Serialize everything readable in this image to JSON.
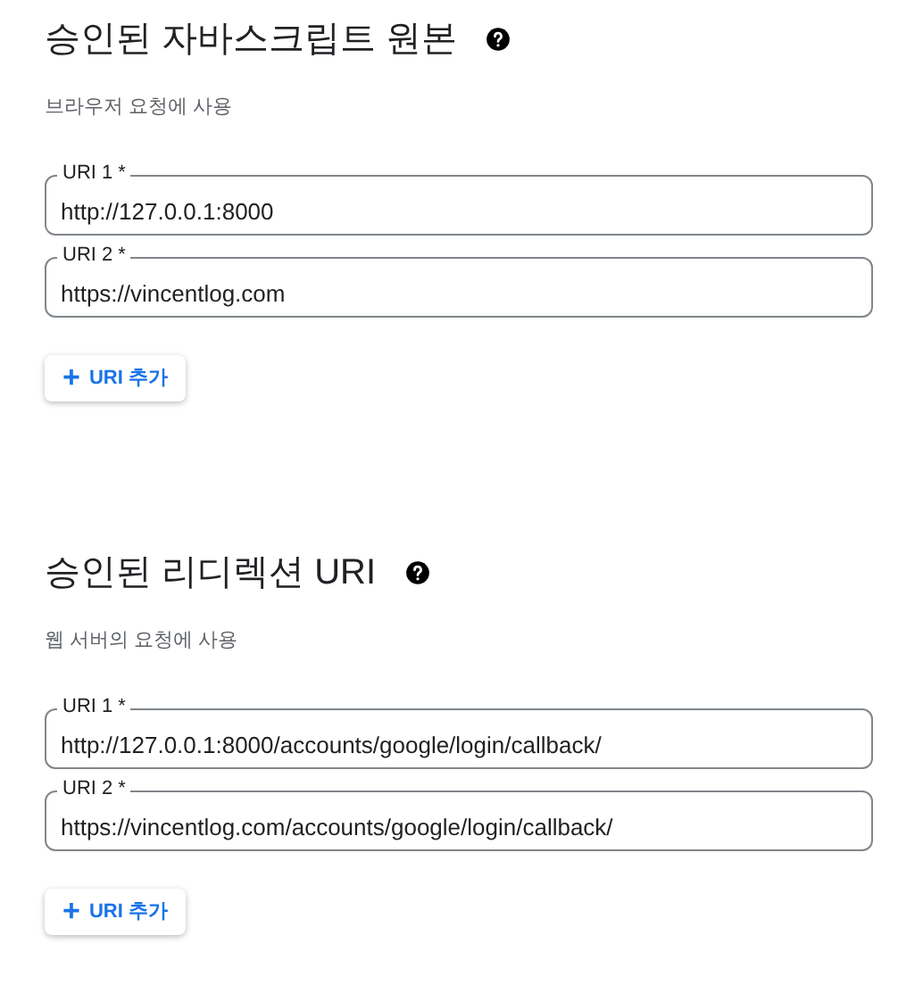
{
  "sections": [
    {
      "title": "승인된 자바스크립트 원본",
      "subtitle": "브라우저 요청에 사용",
      "fields": [
        {
          "label": "URI 1 *",
          "value": "http://127.0.0.1:8000"
        },
        {
          "label": "URI 2 *",
          "value": "https://vincentlog.com"
        }
      ],
      "add_button": {
        "icon": "+",
        "label": "URI 추가"
      }
    },
    {
      "title": "승인된 리디렉션 URI",
      "subtitle": "웹 서버의 요청에 사용",
      "fields": [
        {
          "label": "URI 1 *",
          "value": "http://127.0.0.1:8000/accounts/google/login/callback/"
        },
        {
          "label": "URI 2 *",
          "value": "https://vincentlog.com/accounts/google/login/callback/"
        }
      ],
      "add_button": {
        "icon": "+",
        "label": "URI 추가"
      }
    }
  ]
}
